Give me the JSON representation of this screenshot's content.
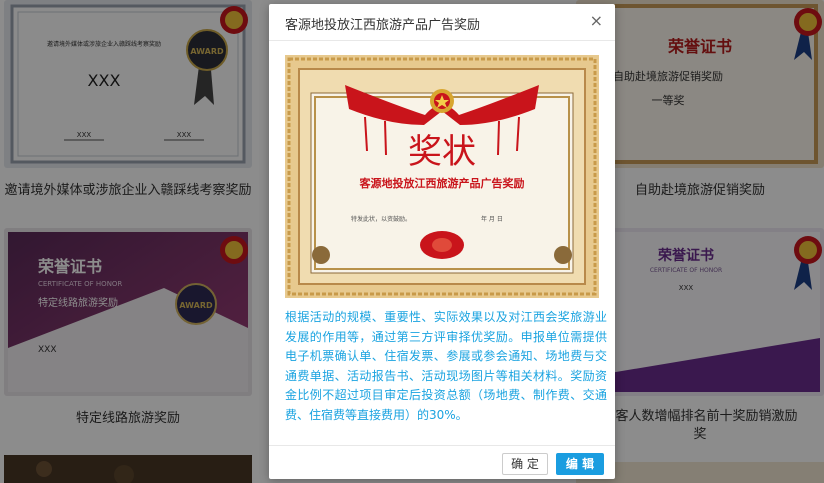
{
  "cards": [
    {
      "caption": "邀请境外媒体或涉旅企业入赣踩线考察奖励",
      "cert_heading": "邀请境外媒体或涉旅企业入赣踩线考察奖励",
      "award_text": "AWARD",
      "name": "XXX",
      "sign1": "XXX",
      "sign2": "XXX"
    },
    {
      "caption": "自助赴境旅游促销奖励",
      "cert_heading": "荣誉证书",
      "award_name": "自助赴境旅游促销奖励",
      "rank": "一等奖"
    },
    {
      "caption": "特定线路旅游奖励",
      "cert_heading": "荣誉证书",
      "cert_sub": "CERTIFICATE OF HONOR",
      "award_name": "特定线路旅游奖励",
      "award_text": "AWARD",
      "name": "XXX"
    },
    {
      "caption_line1": "游客人数增幅排名前十奖励销激励",
      "caption_line2": "奖",
      "cert_heading": "荣誉证书",
      "cert_sub": "CERTIFICATE OF HONOR",
      "name": "XXX"
    }
  ],
  "modal": {
    "title": "客源地投放江西旅游产品广告奖励",
    "close_icon": "close-icon",
    "certificate": {
      "heading": "奖状",
      "award_name": "客源地投放江西旅游产品广告奖励",
      "body_text": "特发此状，以资鼓励。",
      "date_text": "年 月 日"
    },
    "description": "根据活动的规模、重要性、实际效果以及对江西会奖旅游业发展的作用等，通过第三方评审择优奖励。申报单位需提供电子机票确认单、住宿发票、参展或参会通知、场地费与交通费单据、活动报告书、活动现场图片等相关材料。奖励资金比例不超过项目审定后投资总额（场地费、制作费、交通费、住宿费等直接费用）的30%。",
    "ok_label": "确 定",
    "edit_label": "编 辑"
  }
}
